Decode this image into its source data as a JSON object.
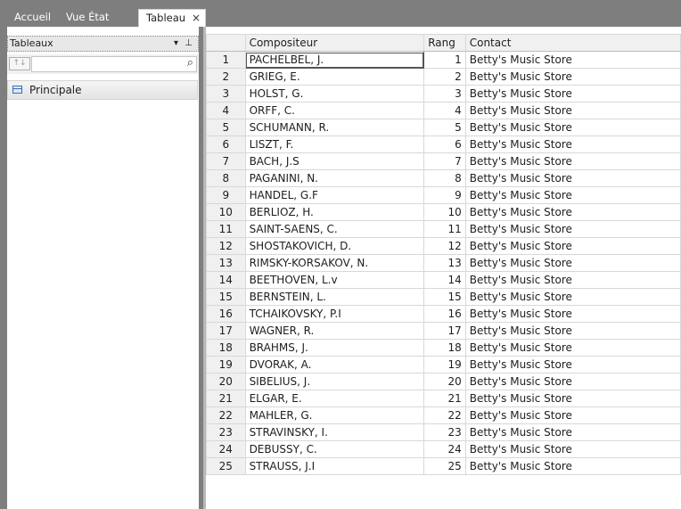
{
  "tabs": [
    {
      "label": "Accueil"
    },
    {
      "label": "Vue État"
    },
    {
      "label": "Tableau",
      "active": true
    }
  ],
  "tab_close_glyph": "×",
  "panel": {
    "title": "Tableaux",
    "dropdown_glyph": "▾",
    "pin_glyph": "ᵖ",
    "sort_glyph": "↑↓",
    "search_placeholder": "",
    "items": [
      {
        "label": "Principale"
      }
    ]
  },
  "table": {
    "columns": [
      "",
      "Compositeur",
      "Rang",
      "Contact"
    ],
    "rows": [
      {
        "n": "1",
        "composer": "PACHELBEL, J.",
        "rank": "1",
        "contact": "Betty's Music Store"
      },
      {
        "n": "2",
        "composer": "GRIEG, E.",
        "rank": "2",
        "contact": "Betty's Music Store"
      },
      {
        "n": "3",
        "composer": "HOLST, G.",
        "rank": "3",
        "contact": "Betty's Music Store"
      },
      {
        "n": "4",
        "composer": "ORFF, C.",
        "rank": "4",
        "contact": "Betty's Music Store"
      },
      {
        "n": "5",
        "composer": "SCHUMANN, R.",
        "rank": "5",
        "contact": "Betty's Music Store"
      },
      {
        "n": "6",
        "composer": "LISZT, F.",
        "rank": "6",
        "contact": "Betty's Music Store"
      },
      {
        "n": "7",
        "composer": "BACH, J.S",
        "rank": "7",
        "contact": "Betty's Music Store"
      },
      {
        "n": "8",
        "composer": "PAGANINI, N.",
        "rank": "8",
        "contact": "Betty's Music Store"
      },
      {
        "n": "9",
        "composer": "HANDEL, G.F",
        "rank": "9",
        "contact": "Betty's Music Store"
      },
      {
        "n": "10",
        "composer": "BERLIOZ, H.",
        "rank": "10",
        "contact": "Betty's Music Store"
      },
      {
        "n": "11",
        "composer": "SAINT-SAENS, C.",
        "rank": "11",
        "contact": "Betty's Music Store"
      },
      {
        "n": "12",
        "composer": "SHOSTAKOVICH, D.",
        "rank": "12",
        "contact": "Betty's Music Store"
      },
      {
        "n": "13",
        "composer": "RIMSKY-KORSAKOV, N.",
        "rank": "13",
        "contact": "Betty's Music Store"
      },
      {
        "n": "14",
        "composer": "BEETHOVEN, L.v",
        "rank": "14",
        "contact": "Betty's Music Store"
      },
      {
        "n": "15",
        "composer": "BERNSTEIN, L.",
        "rank": "15",
        "contact": "Betty's Music Store"
      },
      {
        "n": "16",
        "composer": "TCHAIKOVSKY, P.I",
        "rank": "16",
        "contact": "Betty's Music Store"
      },
      {
        "n": "17",
        "composer": "WAGNER, R.",
        "rank": "17",
        "contact": "Betty's Music Store"
      },
      {
        "n": "18",
        "composer": "BRAHMS, J.",
        "rank": "18",
        "contact": "Betty's Music Store"
      },
      {
        "n": "19",
        "composer": "DVORAK, A.",
        "rank": "19",
        "contact": "Betty's Music Store"
      },
      {
        "n": "20",
        "composer": "SIBELIUS, J.",
        "rank": "20",
        "contact": "Betty's Music Store"
      },
      {
        "n": "21",
        "composer": "ELGAR, E.",
        "rank": "21",
        "contact": "Betty's Music Store"
      },
      {
        "n": "22",
        "composer": "MAHLER, G.",
        "rank": "22",
        "contact": "Betty's Music Store"
      },
      {
        "n": "23",
        "composer": "STRAVINSKY, I.",
        "rank": "23",
        "contact": "Betty's Music Store"
      },
      {
        "n": "24",
        "composer": "DEBUSSY, C.",
        "rank": "24",
        "contact": "Betty's Music Store"
      },
      {
        "n": "25",
        "composer": "STRAUSS, J.I",
        "rank": "25",
        "contact": "Betty's Music Store"
      }
    ]
  }
}
